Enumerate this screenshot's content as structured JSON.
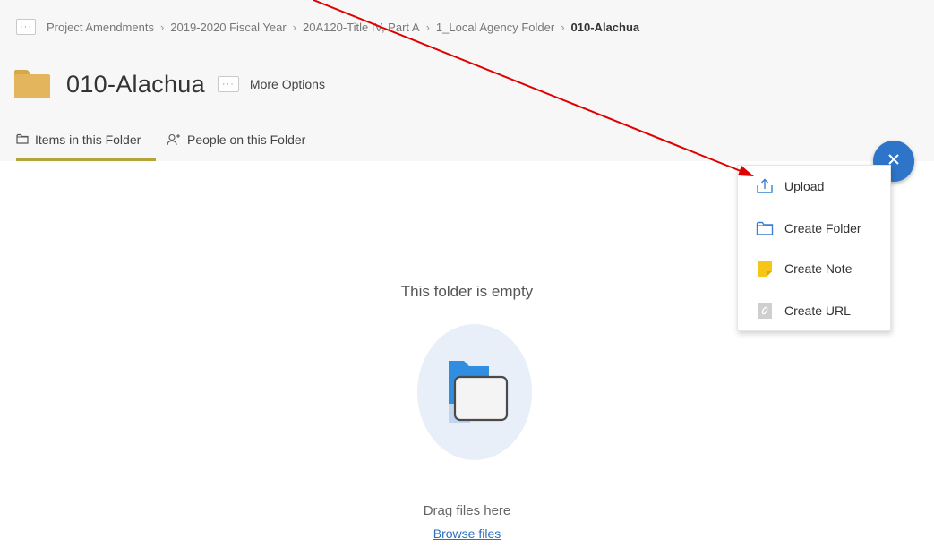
{
  "breadcrumb": {
    "overflow_label": "···",
    "items": [
      "Project Amendments",
      "2019-2020 Fiscal Year",
      "20A120-Title IV, Part A",
      "1_Local Agency Folder"
    ],
    "current": "010-Alachua",
    "separator": "›"
  },
  "folder": {
    "title": "010-Alachua",
    "more_options_icon": "···",
    "more_options_label": "More Options"
  },
  "tabs": [
    {
      "label": "Items in this Folder",
      "icon": "folder-outline-icon",
      "active": true
    },
    {
      "label": "People on this Folder",
      "icon": "person-add-icon",
      "active": false
    }
  ],
  "fab": {
    "icon": "close-icon",
    "label": "×"
  },
  "add_menu": {
    "items": [
      {
        "label": "Upload",
        "icon": "upload-icon"
      },
      {
        "label": "Create Folder",
        "icon": "folder-outline-icon"
      },
      {
        "label": "Create Note",
        "icon": "note-icon"
      },
      {
        "label": "Create URL",
        "icon": "link-icon"
      }
    ]
  },
  "empty_state": {
    "message": "This folder is empty",
    "drag_text": "Drag files here",
    "browse_link": "Browse files"
  },
  "colors": {
    "accent": "#2e74c8",
    "tab_underline": "#b5a437",
    "folder_icon": "#e3b65d",
    "note_icon": "#f5c518",
    "annotation_arrow": "#e00000"
  }
}
